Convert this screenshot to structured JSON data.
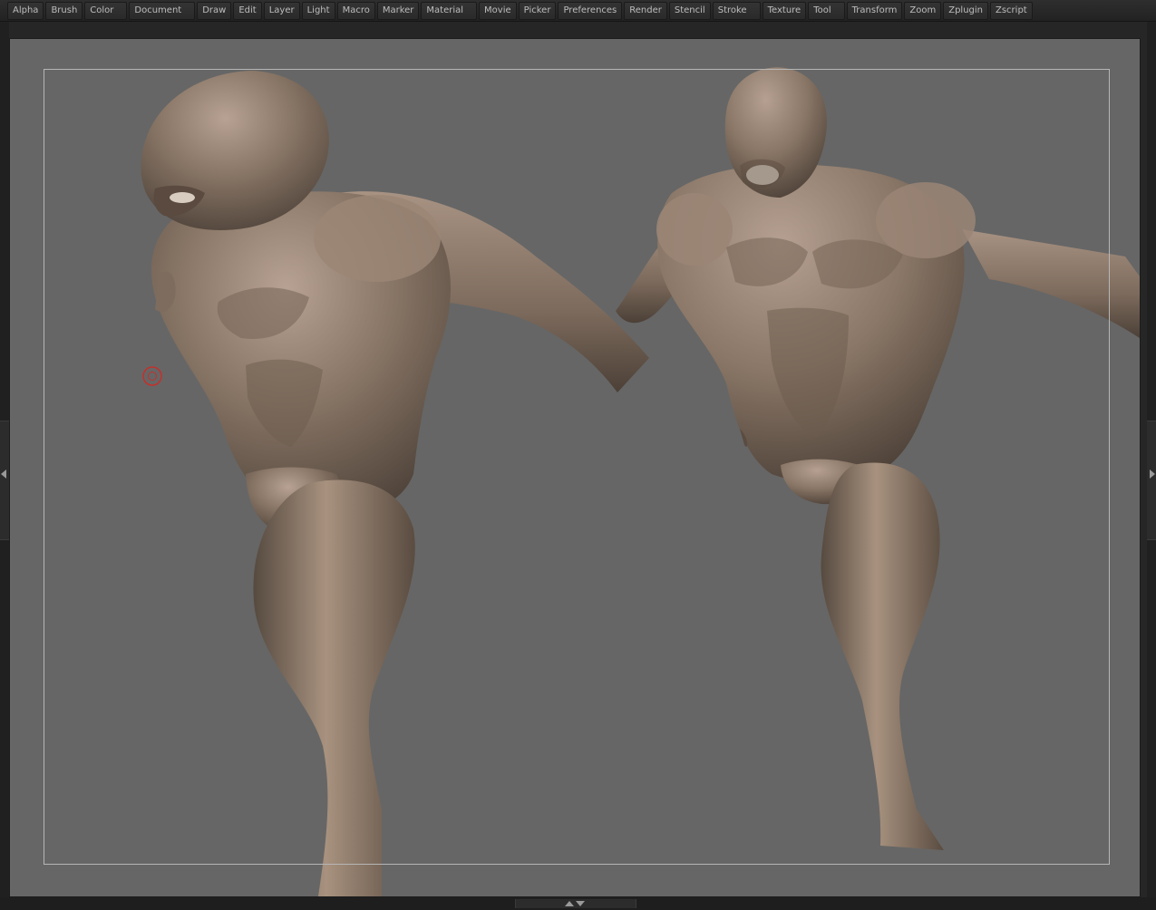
{
  "menu": {
    "items": [
      {
        "id": "alpha",
        "label": "Alpha"
      },
      {
        "id": "brush",
        "label": "Brush"
      },
      {
        "id": "color",
        "label": "Color"
      },
      {
        "id": "document",
        "label": "Document"
      },
      {
        "id": "draw",
        "label": "Draw"
      },
      {
        "id": "edit",
        "label": "Edit"
      },
      {
        "id": "layer",
        "label": "Layer"
      },
      {
        "id": "light",
        "label": "Light"
      },
      {
        "id": "macro",
        "label": "Macro"
      },
      {
        "id": "marker",
        "label": "Marker"
      },
      {
        "id": "material",
        "label": "Material"
      },
      {
        "id": "movie",
        "label": "Movie"
      },
      {
        "id": "picker",
        "label": "Picker"
      },
      {
        "id": "preferences",
        "label": "Preferences"
      },
      {
        "id": "render",
        "label": "Render"
      },
      {
        "id": "stencil",
        "label": "Stencil"
      },
      {
        "id": "stroke",
        "label": "Stroke"
      },
      {
        "id": "texture",
        "label": "Texture"
      },
      {
        "id": "tool",
        "label": "Tool"
      },
      {
        "id": "transform",
        "label": "Transform"
      },
      {
        "id": "zoom",
        "label": "Zoom"
      },
      {
        "id": "zplugin",
        "label": "Zplugin"
      },
      {
        "id": "zscript",
        "label": "Zscript"
      }
    ]
  },
  "colors": {
    "canvas_bg": "#666666",
    "model_clay": "#8a7767",
    "model_highlight": "#b8a393",
    "model_shadow": "#4e4138",
    "brush_cursor": "#c4302b"
  },
  "icons": {
    "brush_cursor": "brush-cursor-icon",
    "tray_left": "chevron-left-icon",
    "tray_right": "chevron-right-icon",
    "bottom_tray": "chevron-up-down-icon"
  }
}
